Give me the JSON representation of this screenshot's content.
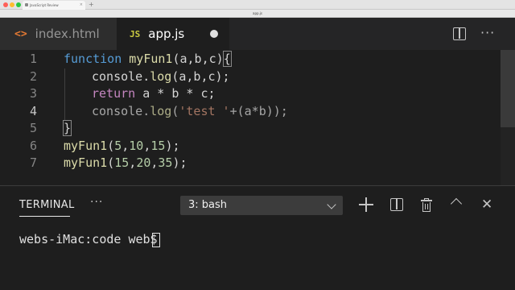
{
  "browser": {
    "tab_title": "JavaScript Review",
    "tab_close": "×",
    "new_tab": "+"
  },
  "window": {
    "title": "app.js"
  },
  "tabs": [
    {
      "icon": "<>",
      "label": "index.html"
    },
    {
      "icon": "JS",
      "label": "app.js"
    }
  ],
  "toolbar": {
    "more": "···"
  },
  "editor": {
    "line_numbers": [
      "1",
      "2",
      "3",
      "4",
      "5",
      "6",
      "7"
    ],
    "lines": {
      "l1_kw": "function",
      "l1_fn": "myFun1",
      "l1_rest": "(a,b,c)",
      "l1_brace": "{",
      "l2_obj": "console",
      "l2_dot": ".",
      "l2_fn": "log",
      "l2_rest": "(a,b,c);",
      "l3_kw": "return",
      "l3_rest": " a * b * c;",
      "l4_obj": "console",
      "l4_dot": ".",
      "l4_fn": "log",
      "l4_paren": "(",
      "l4_str": "'test '",
      "l4_rest": "+(a*b));",
      "l5": "}",
      "l6_fn": "myFun1",
      "l6_open": "(",
      "l6_n1": "5",
      "l6_c1": ",",
      "l6_n2": "10",
      "l6_c2": ",",
      "l6_n3": "15",
      "l6_close": ");",
      "l7_fn": "myFun1",
      "l7_open": "(",
      "l7_n1": "15",
      "l7_c1": ",",
      "l7_n2": "20",
      "l7_c2": ",",
      "l7_n3": "35",
      "l7_close": ");"
    }
  },
  "panel": {
    "title": "TERMINAL",
    "more": "···",
    "shell": "3: bash",
    "close": "✕",
    "prompt": "webs-iMac:code web$ "
  }
}
